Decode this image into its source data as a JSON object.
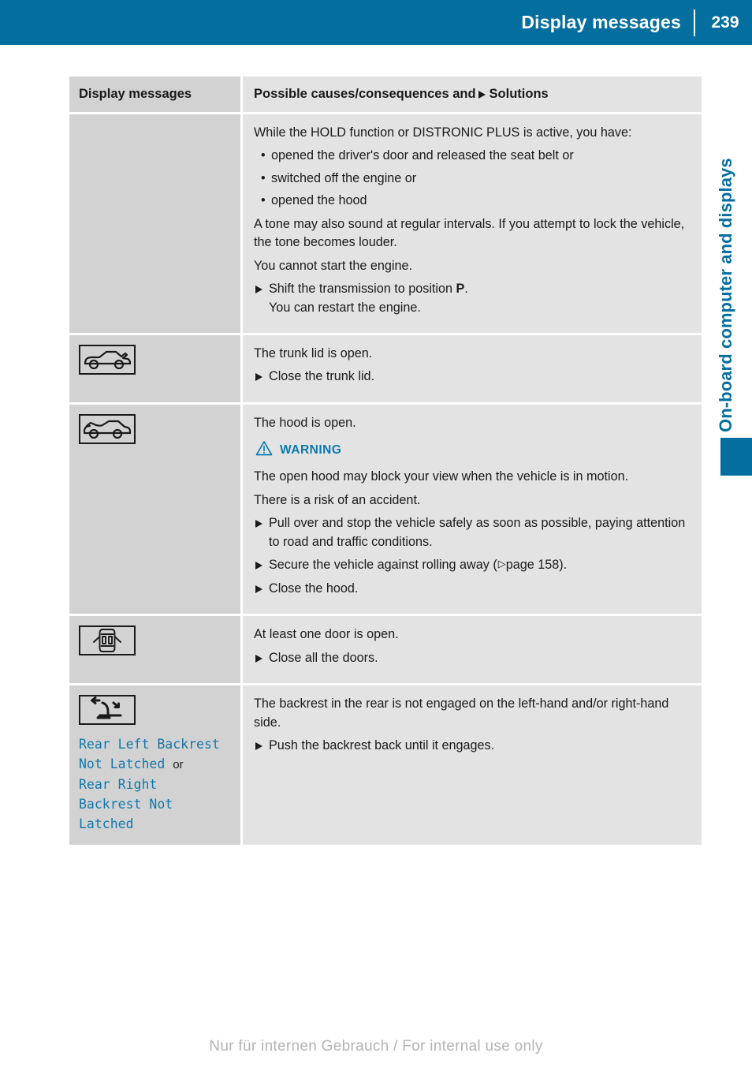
{
  "header": {
    "title": "Display messages",
    "page_number": "239",
    "bar_color": "#046e9e"
  },
  "sidebar": {
    "chapter_label": "On-board computer and displays",
    "accent_color": "#046e9e"
  },
  "table": {
    "columns": {
      "left_header": "Display messages",
      "right_header_before_arrow": "Possible causes/consequences and",
      "right_header_after_arrow": "Solutions"
    },
    "rows": [
      {
        "icon": "none",
        "intro": "While the HOLD function or DISTRONIC PLUS is active, you have:",
        "bullets": [
          "opened the driver's door and released the seat belt or",
          "switched off the engine or",
          "opened the hood"
        ],
        "paragraphs": [
          "A tone may also sound at regular intervals. If you attempt to lock the vehicle, the tone becomes louder.",
          "You cannot start the engine."
        ],
        "step_text_before_bold": "Shift the transmission to position ",
        "step_bold": "P",
        "step_text_after_bold": ".",
        "step_sub": "You can restart the engine."
      },
      {
        "icon": "trunk-open-icon",
        "paragraph": "The trunk lid is open.",
        "step": "Close the trunk lid."
      },
      {
        "icon": "hood-open-icon",
        "paragraph": "The hood is open.",
        "warning_label": "WARNING",
        "warning_lines": [
          "The open hood may block your view when the vehicle is in motion.",
          "There is a risk of an accident."
        ],
        "steps": [
          "Pull over and stop the vehicle safely as soon as possible, paying attention to road and traffic conditions.",
          "Close the hood."
        ],
        "step_with_ref_before": "Secure the vehicle against rolling away (",
        "step_with_ref_page": "page 158",
        "step_with_ref_after": ")."
      },
      {
        "icon": "door-open-icon",
        "paragraph": "At least one door is open.",
        "step": "Close all the doors."
      },
      {
        "icon": "backrest-not-latched-icon",
        "message_code_line1": "Rear Left Backrest",
        "message_code_line2": "Not Latched",
        "message_code_or": "or",
        "message_code_line3": "Rear Right",
        "message_code_line4": "Backrest Not",
        "message_code_line5": "Latched",
        "message_code_color": "#1477a8",
        "paragraph": "The backrest in the rear is not engaged on the left-hand and/or right-hand side.",
        "step": "Push the backrest back until it engages."
      }
    ]
  },
  "footer": {
    "watermark": "Nur für internen Gebrauch / For internal use only"
  }
}
